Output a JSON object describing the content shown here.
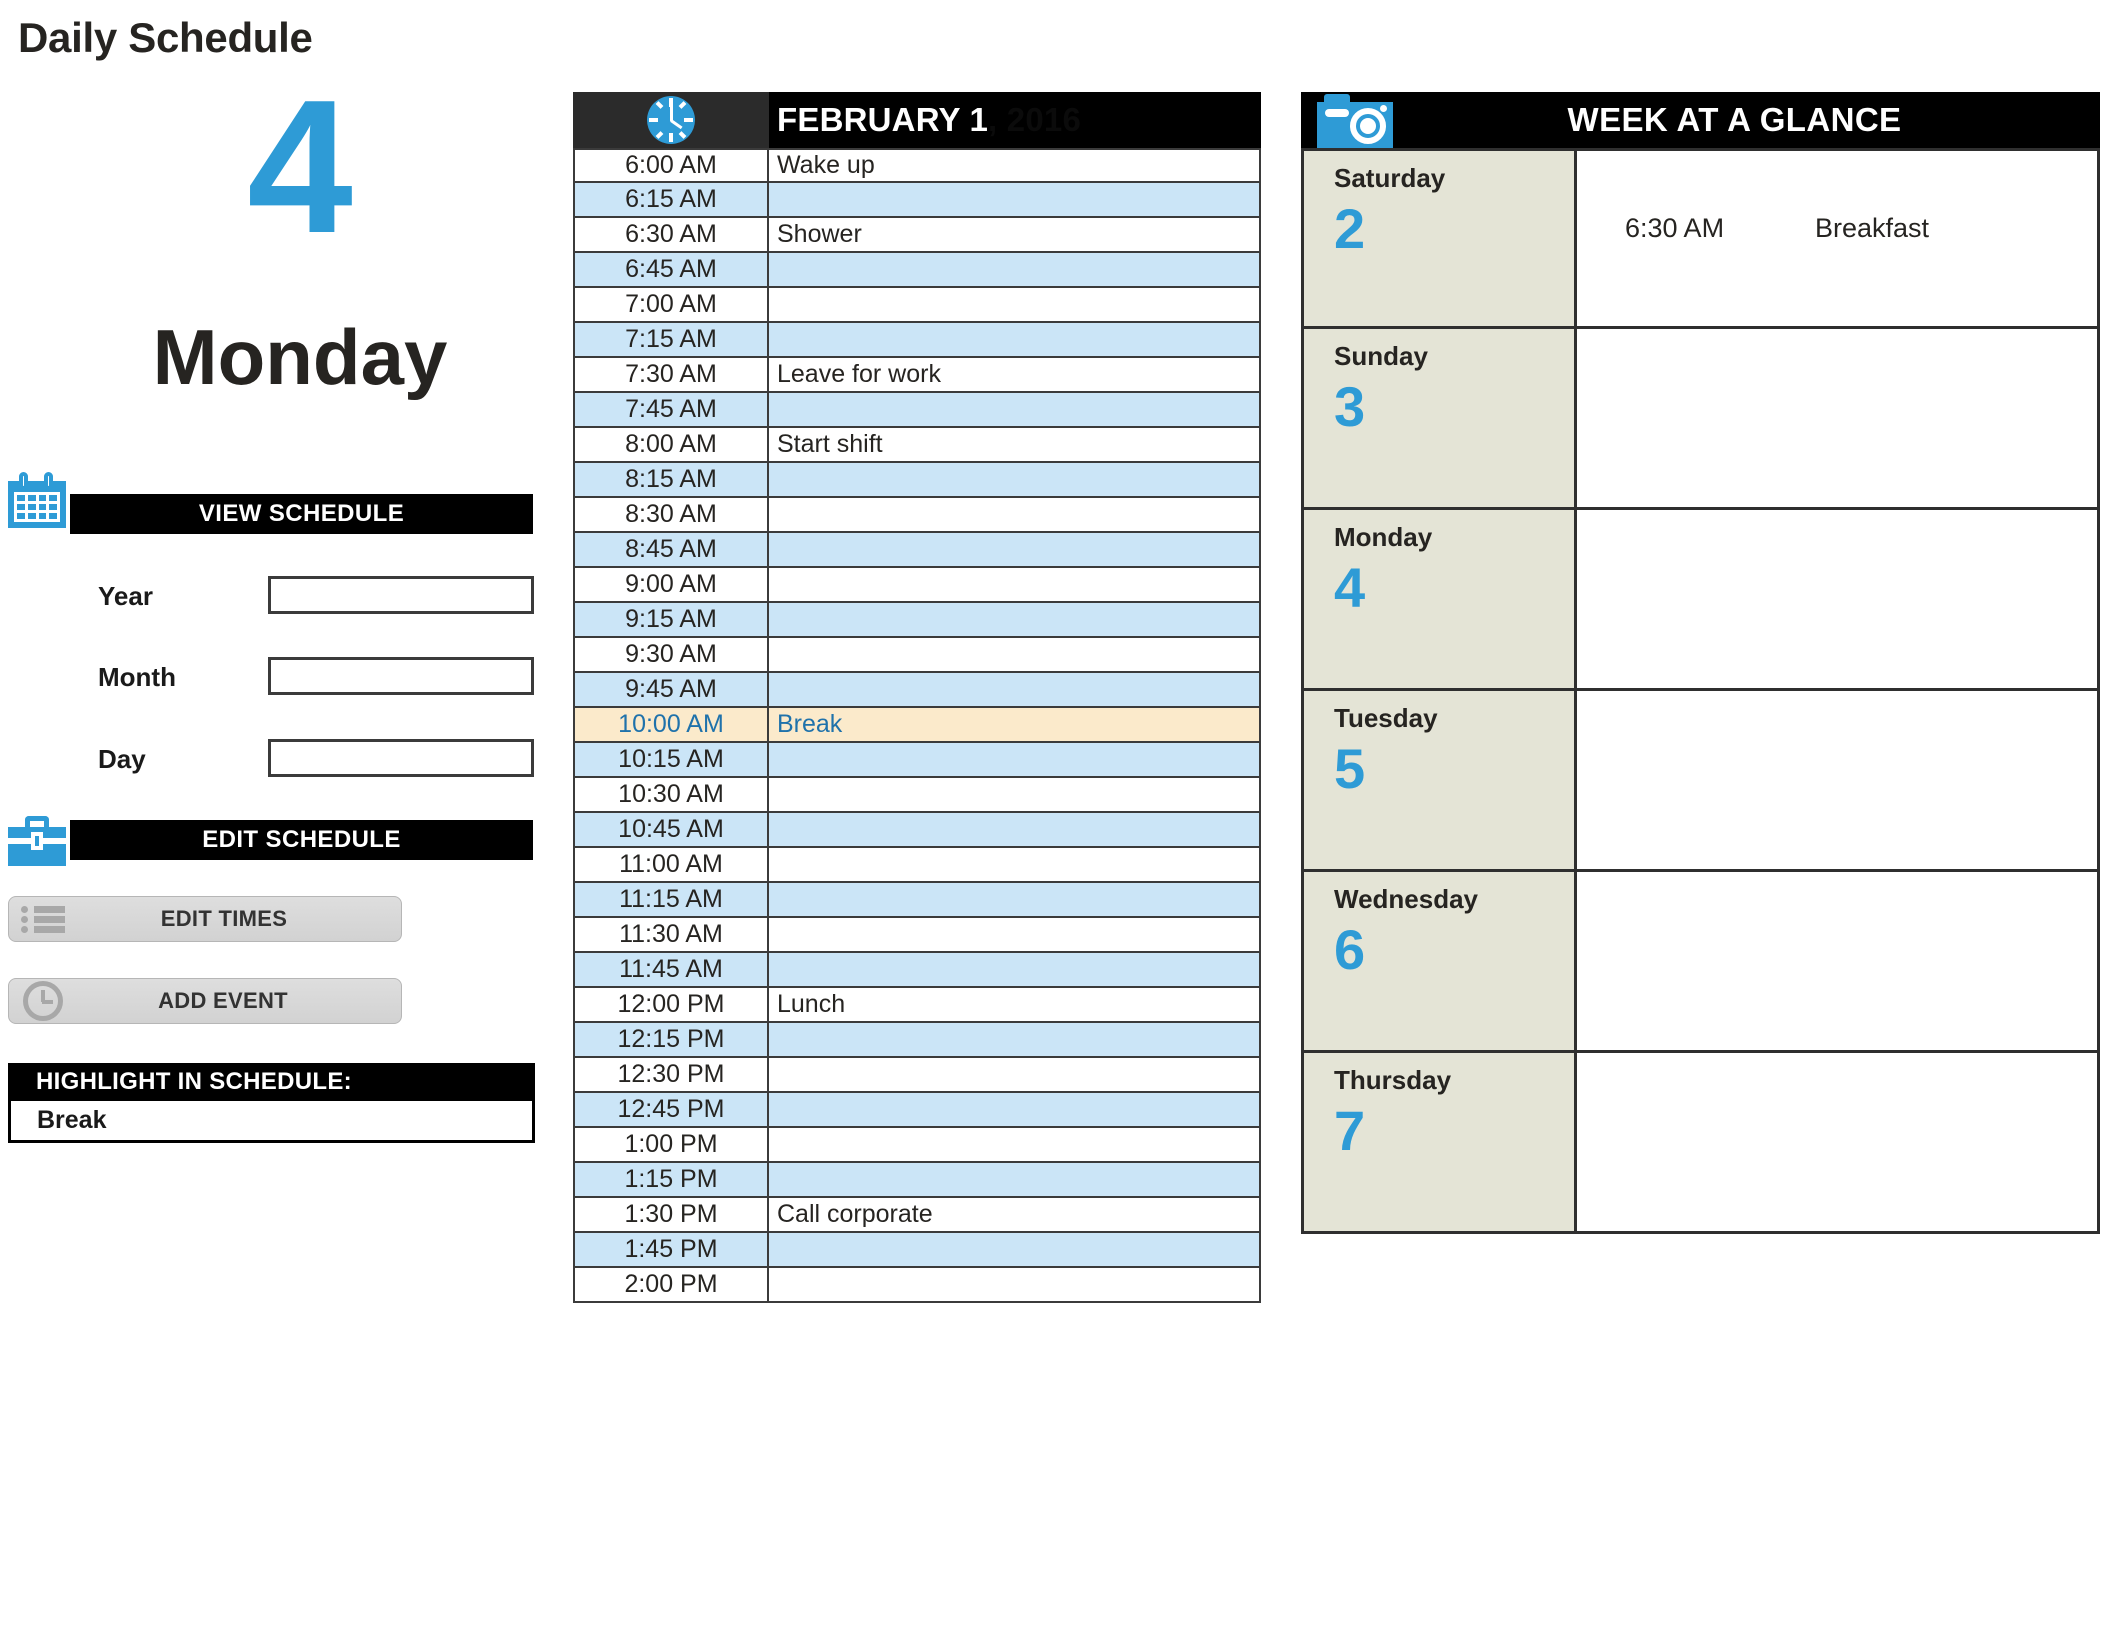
{
  "document": {
    "title": "Daily Schedule"
  },
  "day_display": {
    "number": "4",
    "weekday": "Monday"
  },
  "view_schedule": {
    "header": "VIEW SCHEDULE",
    "icon": "calendar-icon",
    "fields": [
      {
        "label": "Year",
        "value": "",
        "placeholder": ""
      },
      {
        "label": "Month",
        "value": "",
        "placeholder": ""
      },
      {
        "label": "Day",
        "value": "",
        "placeholder": ""
      }
    ]
  },
  "edit_schedule": {
    "header": "EDIT SCHEDULE",
    "icon": "briefcase-icon",
    "buttons": [
      {
        "label": "EDIT TIMES",
        "icon": "list-icon"
      },
      {
        "label": "ADD EVENT",
        "icon": "clock-icon"
      }
    ]
  },
  "highlight": {
    "header": "HIGHLIGHT IN SCHEDULE:",
    "value": "Break"
  },
  "schedule": {
    "icon": "clock-icon",
    "title": "FEBRUARY 1",
    "title_faded": ", 2016",
    "rows": [
      {
        "time": "6:00 AM",
        "event": "Wake up",
        "style": "plain"
      },
      {
        "time": "6:15 AM",
        "event": "",
        "style": "alt"
      },
      {
        "time": "6:30 AM",
        "event": "Shower",
        "style": "plain"
      },
      {
        "time": "6:45 AM",
        "event": "",
        "style": "alt"
      },
      {
        "time": "7:00 AM",
        "event": "",
        "style": "plain"
      },
      {
        "time": "7:15 AM",
        "event": "",
        "style": "alt"
      },
      {
        "time": "7:30 AM",
        "event": "Leave for work",
        "style": "plain"
      },
      {
        "time": "7:45 AM",
        "event": "",
        "style": "alt"
      },
      {
        "time": "8:00 AM",
        "event": "Start shift",
        "style": "plain"
      },
      {
        "time": "8:15 AM",
        "event": "",
        "style": "alt"
      },
      {
        "time": "8:30 AM",
        "event": "",
        "style": "plain"
      },
      {
        "time": "8:45 AM",
        "event": "",
        "style": "alt"
      },
      {
        "time": "9:00 AM",
        "event": "",
        "style": "plain"
      },
      {
        "time": "9:15 AM",
        "event": "",
        "style": "alt"
      },
      {
        "time": "9:30 AM",
        "event": "",
        "style": "plain"
      },
      {
        "time": "9:45 AM",
        "event": "",
        "style": "alt"
      },
      {
        "time": "10:00 AM",
        "event": "Break",
        "style": "hl"
      },
      {
        "time": "10:15 AM",
        "event": "",
        "style": "alt"
      },
      {
        "time": "10:30 AM",
        "event": "",
        "style": "plain"
      },
      {
        "time": "10:45 AM",
        "event": "",
        "style": "alt"
      },
      {
        "time": "11:00 AM",
        "event": "",
        "style": "plain"
      },
      {
        "time": "11:15 AM",
        "event": "",
        "style": "alt"
      },
      {
        "time": "11:30 AM",
        "event": "",
        "style": "plain"
      },
      {
        "time": "11:45 AM",
        "event": "",
        "style": "alt"
      },
      {
        "time": "12:00 PM",
        "event": "Lunch",
        "style": "plain"
      },
      {
        "time": "12:15 PM",
        "event": "",
        "style": "alt"
      },
      {
        "time": "12:30 PM",
        "event": "",
        "style": "plain"
      },
      {
        "time": "12:45 PM",
        "event": "",
        "style": "alt"
      },
      {
        "time": "1:00 PM",
        "event": "",
        "style": "plain"
      },
      {
        "time": "1:15 PM",
        "event": "",
        "style": "alt"
      },
      {
        "time": "1:30 PM",
        "event": "Call corporate",
        "style": "plain"
      },
      {
        "time": "1:45 PM",
        "event": "",
        "style": "alt"
      },
      {
        "time": "2:00 PM",
        "event": "",
        "style": "plain"
      }
    ]
  },
  "week_at_a_glance": {
    "icon": "camera-icon",
    "title": "WEEK AT A GLANCE",
    "days": [
      {
        "name": "Saturday",
        "number": "2",
        "events": [
          {
            "time": "6:30 AM",
            "event": "Breakfast"
          }
        ]
      },
      {
        "name": "Sunday",
        "number": "3",
        "events": []
      },
      {
        "name": "Monday",
        "number": "4",
        "events": []
      },
      {
        "name": "Tuesday",
        "number": "5",
        "events": []
      },
      {
        "name": "Wednesday",
        "number": "6",
        "events": []
      },
      {
        "name": "Thursday",
        "number": "7",
        "events": []
      }
    ]
  },
  "colors": {
    "accent_blue": "#2e9bd6",
    "row_alt_blue": "#cbe5f7",
    "highlight_cream": "#fbeacb",
    "highlight_text": "#1f72ab",
    "day_col_beige": "#e4e4d6",
    "header_black": "#000000",
    "text_dark": "#262421"
  }
}
